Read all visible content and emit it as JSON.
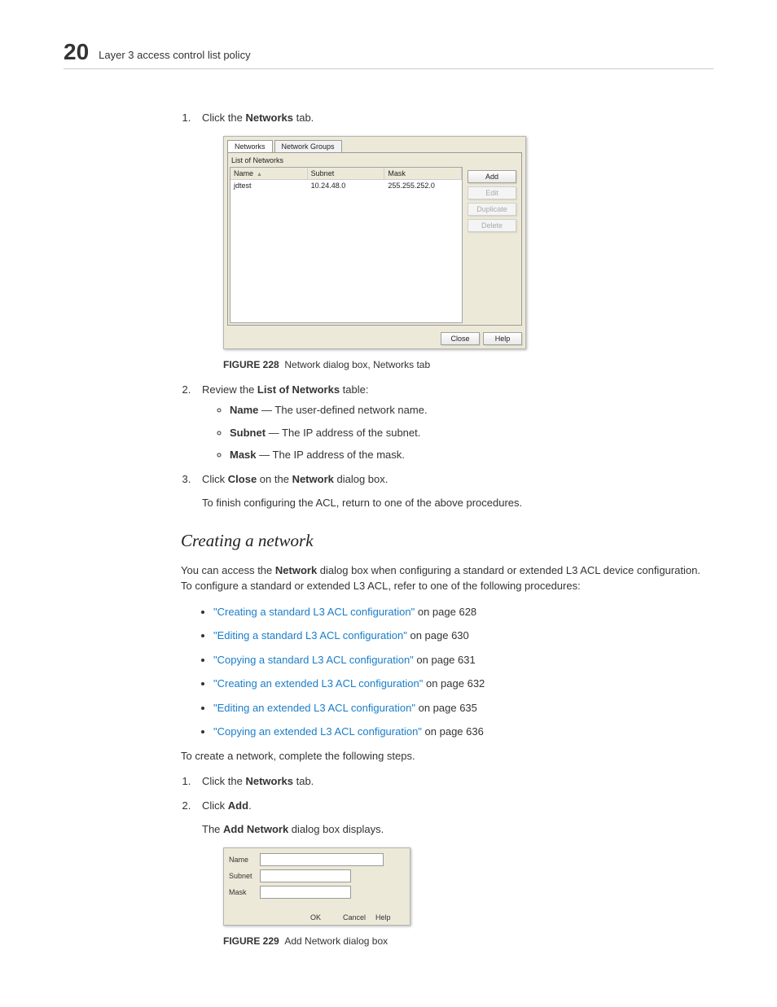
{
  "header": {
    "chapter_number": "20",
    "chapter_title": "Layer 3 access control list policy"
  },
  "steps_a": {
    "s1": {
      "pre": "Click the ",
      "bold": "Networks",
      "post": " tab."
    },
    "s2": {
      "pre": "Review the ",
      "bold": "List of Networks",
      "post": " table:",
      "bullets": {
        "b1": {
          "bold": "Name",
          "text": " — The user-defined network name."
        },
        "b2": {
          "bold": "Subnet",
          "text": " — The IP address of the subnet."
        },
        "b3": {
          "bold": "Mask",
          "text": " — The IP address of the mask."
        }
      }
    },
    "s3": {
      "pre": "Click ",
      "bold1": "Close",
      "mid": " on the ",
      "bold2": "Network",
      "post": " dialog box.",
      "post_para": "To finish configuring the ACL, return to one of the above procedures."
    }
  },
  "fig228": {
    "label": "FIGURE 228",
    "caption": "Network dialog box, Networks tab",
    "ui": {
      "tab_networks": "Networks",
      "tab_groups": "Network Groups",
      "panel_title": "List of Networks",
      "col_name": "Name",
      "col_subnet": "Subnet",
      "col_mask": "Mask",
      "row_name": "jdtest",
      "row_subnet": "10.24.48.0",
      "row_mask": "255.255.252.0",
      "btn_add": "Add",
      "btn_edit": "Edit",
      "btn_dup": "Duplicate",
      "btn_del": "Delete",
      "btn_close": "Close",
      "btn_help": "Help"
    }
  },
  "section_heading": "Creating a network",
  "intro": {
    "pre": "You can access the ",
    "bold": "Network",
    "post": " dialog box when configuring a standard or extended L3 ACL device configuration. To configure a standard or extended L3 ACL, refer to one of the following procedures:"
  },
  "links": {
    "l1": {
      "text": "\"Creating a standard L3 ACL configuration\"",
      "suffix": " on page 628"
    },
    "l2": {
      "text": "\"Editing a standard L3 ACL configuration\"",
      "suffix": " on page 630"
    },
    "l3": {
      "text": "\"Copying a standard L3 ACL configuration\"",
      "suffix": " on page 631"
    },
    "l4": {
      "text": "\"Creating an extended L3 ACL configuration\"",
      "suffix": " on page 632"
    },
    "l5": {
      "text": "\"Editing an extended L3 ACL configuration\"",
      "suffix": " on page 635"
    },
    "l6": {
      "text": "\"Copying an extended L3 ACL configuration\"",
      "suffix": " on page 636"
    }
  },
  "create_intro": "To create a network, complete the following steps.",
  "steps_b": {
    "s1": {
      "pre": "Click the ",
      "bold": "Networks",
      "post": " tab."
    },
    "s2": {
      "pre": "Click ",
      "bold": "Add",
      "post": ".",
      "after_pre": "The ",
      "after_bold": "Add Network",
      "after_post": " dialog box displays."
    }
  },
  "fig229": {
    "label": "FIGURE 229",
    "caption": "Add Network dialog box",
    "ui": {
      "lbl_name": "Name",
      "lbl_subnet": "Subnet",
      "lbl_mask": "Mask",
      "btn_ok": "OK",
      "btn_cancel": "Cancel",
      "btn_help": "Help"
    }
  }
}
